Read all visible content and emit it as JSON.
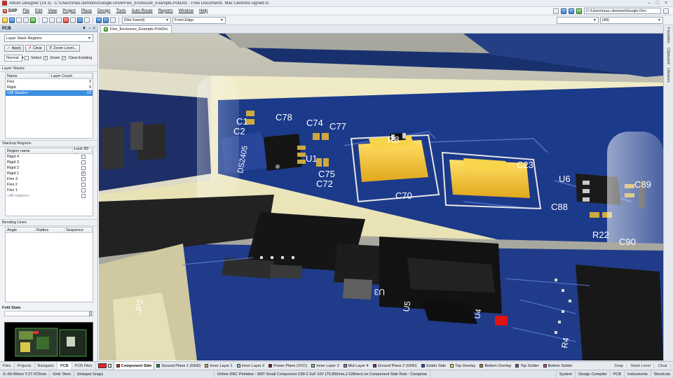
{
  "window": {
    "title": "Altium Designer (14.3) - C:\\Users\\max.clemons\\Google Drive\\Flex_Enclosure_Example.PcbDoc - Free Documents. Max Clemons signed in."
  },
  "menu": {
    "items": [
      "DXP",
      "File",
      "Edit",
      "View",
      "Project",
      "Place",
      "Design",
      "Tools",
      "Auto Route",
      "Reports",
      "Window",
      "Help"
    ],
    "path": "C:\\Users\\max.clemons\\Google Driv"
  },
  "toolbar": {
    "view_config": "(Not Saved)",
    "view_from": "Front Edge",
    "filter": "(All)"
  },
  "panel": {
    "title": "PCB",
    "mode": "Layer Stack Regions",
    "apply": "Apply",
    "clear": "Clear",
    "zoom_level": "Zoom Level...",
    "normal": "Normal",
    "select": "Select",
    "zoom": "Zoom",
    "clear_existing": "Clear Existing",
    "layer_stacks": {
      "label": "Layer Stacks",
      "headers": [
        "Name",
        "Layer Count"
      ],
      "rows": [
        {
          "name": "Flex",
          "count": "3"
        },
        {
          "name": "Rigid",
          "count": "9"
        },
        {
          "name": "<All Stacks>",
          "count": "23"
        }
      ]
    },
    "stackup_regions": {
      "label": "Stackup Regions",
      "headers": [
        "Region name",
        "Lock 3D ..."
      ],
      "rows": [
        {
          "name": "Rigid 4",
          "lock": ""
        },
        {
          "name": "Rigid 3",
          "lock": ""
        },
        {
          "name": "Rigid 2",
          "lock": ""
        },
        {
          "name": "Rigid 1",
          "lock": "✓"
        },
        {
          "name": "Flex 3",
          "lock": ""
        },
        {
          "name": "Flex 2",
          "lock": ""
        },
        {
          "name": "Flex 1",
          "lock": ""
        },
        {
          "name": "<All regions>",
          "lock": ""
        }
      ]
    },
    "bending_lines": {
      "label": "Bending Lines",
      "headers": [
        "Angle",
        "Radius",
        "Sequence"
      ]
    },
    "fold_state": "Fold State"
  },
  "document_tab": "Flex_Enclosure_Example.PcbDoc",
  "right_tabs": [
    "Favorites",
    "Clipboard",
    "Libraries"
  ],
  "pcb_labels": [
    "C1",
    "C2",
    "C78",
    "C74",
    "C77",
    "R8",
    "DS2405",
    "U1",
    "C75",
    "C72",
    "C70",
    "C23",
    "U6",
    "C89",
    "C88",
    "R22",
    "C90",
    "U3",
    "U5",
    "U4",
    "JP2",
    "R4"
  ],
  "bottom_panel_tabs": [
    "Files",
    "Projects",
    "Navigator",
    "PCB",
    "PCB Filter"
  ],
  "layers": [
    {
      "name": "Component Side",
      "color": "#e8232a",
      "active": true
    },
    {
      "name": "Ground Plane 1 (GND)",
      "color": "#2e8b2e"
    },
    {
      "name": "Inner Layer 1",
      "color": "#c8b464"
    },
    {
      "name": "Inner Layer 2",
      "color": "#9fd3e8"
    },
    {
      "name": "Power Plane (VCC)",
      "color": "#8b1e1e"
    },
    {
      "name": "Inner Layer 3",
      "color": "#7ec8a8"
    },
    {
      "name": "Mid-Layer 4",
      "color": "#8e7cc3"
    },
    {
      "name": "Ground Plane 2 (GND)",
      "color": "#7a2a8a"
    },
    {
      "name": "Solder Side",
      "color": "#1f4fd6"
    },
    {
      "name": "Top Overlay",
      "color": "#f2e94e"
    },
    {
      "name": "Bottom Overlay",
      "color": "#a88a3a"
    },
    {
      "name": "Top Solder",
      "color": "#9a3fb0"
    },
    {
      "name": "Bottom Solder",
      "color": "#b0508a"
    }
  ],
  "layerbar_right": [
    "Snap",
    "Mask Level",
    "Clear"
  ],
  "status": {
    "coords": "X:-60.46mm Y:27.472mm",
    "grid": "Grid: 0mm",
    "snap": "(Hotspot Snap)",
    "message": "Online DRC Primitive : SMT Small Component C89-2.2uF 10V (79.893mm,2.628mm) on Component Side Rule : Compone",
    "right": [
      "System",
      "Design Compiler",
      "PCB",
      "Instruments",
      "Shortcuts"
    ]
  }
}
